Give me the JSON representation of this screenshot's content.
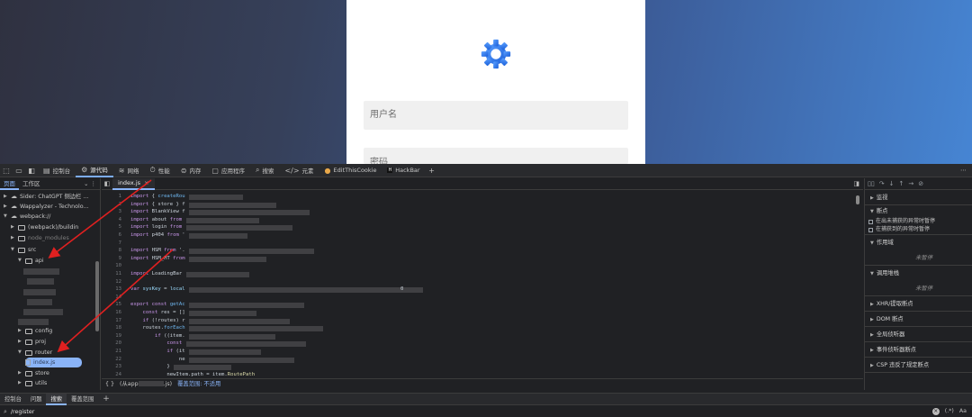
{
  "login": {
    "username_placeholder": "用户名",
    "password_placeholder": "密码"
  },
  "devtools": {
    "tabs": [
      {
        "icon": "console-icon",
        "label": "控制台"
      },
      {
        "icon": "sources-icon",
        "label": "源代码",
        "active": true
      },
      {
        "icon": "network-icon",
        "label": "网络"
      },
      {
        "icon": "performance-icon",
        "label": "性能"
      },
      {
        "icon": "memory-icon",
        "label": "内存"
      },
      {
        "icon": "application-icon",
        "label": "应用程序"
      },
      {
        "icon": "search-icon",
        "label": "搜索"
      },
      {
        "icon": "elements-icon",
        "label": "元素"
      },
      {
        "icon": "cookie-icon",
        "label": "EditThisCookie"
      },
      {
        "icon": "hackbar-icon",
        "label": "HackBar"
      }
    ],
    "navigator": {
      "tabs": [
        "页面",
        "工作区"
      ],
      "tree": [
        {
          "label": "Sider: ChatGPT 侧边栏 ...",
          "kind": "cloud",
          "level": 1,
          "open": false
        },
        {
          "label": "Wappalyzer - Technolo...",
          "kind": "cloud",
          "level": 1,
          "open": false
        },
        {
          "label": "webpack://",
          "kind": "cloud",
          "level": 1,
          "open": true
        },
        {
          "label": "(webpack)/buildin",
          "kind": "folder",
          "level": 2,
          "open": false
        },
        {
          "label": "node_modules",
          "kind": "folder",
          "level": 2,
          "open": false,
          "dim": true
        },
        {
          "label": "src",
          "kind": "folder",
          "level": 2,
          "open": true
        },
        {
          "label": "api",
          "kind": "folder",
          "level": 3,
          "open": true
        },
        {
          "label": "config",
          "kind": "folder",
          "level": 3,
          "open": false
        },
        {
          "label": "proj",
          "kind": "folder",
          "level": 3,
          "open": false
        },
        {
          "label": "router",
          "kind": "folder",
          "level": 3,
          "open": true
        },
        {
          "label": "index.js",
          "kind": "file",
          "level": 4,
          "selected": true
        },
        {
          "label": "store",
          "kind": "folder",
          "level": 3,
          "open": false
        },
        {
          "label": "utils",
          "kind": "folder",
          "level": 3,
          "open": false
        }
      ]
    },
    "editor": {
      "tab_label": "index.js",
      "lines": [
        {
          "n": "1",
          "code": "import { createRou"
        },
        {
          "n": "2",
          "code": "import { store } f"
        },
        {
          "n": "3",
          "code": "import BlankView f"
        },
        {
          "n": "4",
          "code": "import about from"
        },
        {
          "n": "5",
          "code": "import login from"
        },
        {
          "n": "6",
          "code": "import p404 from '"
        },
        {
          "n": "7",
          "code": ""
        },
        {
          "n": "8",
          "code": "import HSM from '."
        },
        {
          "n": "9",
          "code": "import HSM_HT from"
        },
        {
          "n": "10",
          "code": ""
        },
        {
          "n": "11",
          "code": "import LoadingBar"
        },
        {
          "n": "12",
          "code": ""
        },
        {
          "n": "13",
          "code": "var sysKey = local"
        },
        {
          "n": "14",
          "code": ""
        },
        {
          "n": "15",
          "code": "export const getAc"
        },
        {
          "n": "16",
          "code": "    const res = []"
        },
        {
          "n": "17",
          "code": "    if (!routes) r"
        },
        {
          "n": "18",
          "code": "    routes.forEach"
        },
        {
          "n": "19",
          "code": "        if ((item."
        },
        {
          "n": "20",
          "code": "            const"
        },
        {
          "n": "21",
          "code": "            if (it"
        },
        {
          "n": "22",
          "code": "                ne"
        },
        {
          "n": "23",
          "code": "            }"
        },
        {
          "n": "24",
          "code": "            newItem.path = item.RoutePath"
        }
      ],
      "trailing_zero": "0",
      "status": {
        "braces": "{ }",
        "from_text": "(从app",
        "from_suffix": ".js)",
        "coverage": "覆盖范围: 不适用"
      }
    },
    "debugger": {
      "sections": [
        {
          "label": "监视"
        },
        {
          "label": "断点"
        }
      ],
      "checks": [
        "在出未捕获的异常时暂停",
        "在捕获到的异常时暂停"
      ],
      "scope_label": "作用域",
      "paused1": "未暂停",
      "callstack_label": "调用堆栈",
      "paused2": "未暂停",
      "more_sections": [
        "XHR/提取断点",
        "DOM 断点",
        "全局侦听器",
        "事件侦听器断点",
        "CSP 违反了规定断点"
      ]
    },
    "drawer": {
      "tabs": [
        "控制台",
        "问题",
        "搜索",
        "覆盖范围"
      ],
      "active_tab": "搜索",
      "search_value": "/register",
      "regex_label": "(.*)",
      "case_label": "Aa"
    }
  }
}
